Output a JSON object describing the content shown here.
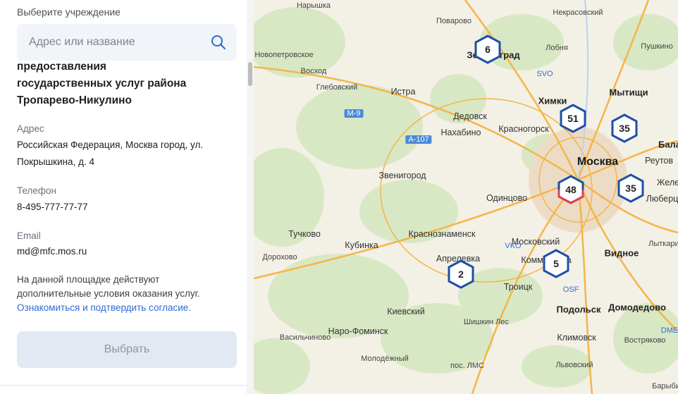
{
  "panel": {
    "title": "Выберите учреждение",
    "search_placeholder": "Адрес или название",
    "org_name_lines": [
      "предоставления",
      "государственных услуг района",
      "Тропарево-Никулино"
    ],
    "address_label": "Адрес",
    "address_value": "Российская Федерация, Москва город, ул. Покрышкина, д. 4",
    "phone_label": "Телефон",
    "phone_value": "8-495-777-77-77",
    "email_label": "Email",
    "email_value": "md@mfc.mos.ru",
    "note_text": "На данной площадке действуют дополнительные условия оказания услуг.",
    "note_link": "Ознакомиться и подтвердить согласие.",
    "select_button": "Выбрать"
  },
  "map": {
    "clusters": [
      {
        "count": "6"
      },
      {
        "count": "51"
      },
      {
        "count": "35"
      },
      {
        "count": "48",
        "selected": true
      },
      {
        "count": "35"
      },
      {
        "count": "2"
      },
      {
        "count": "5"
      }
    ],
    "places": [
      "Нарышка",
      "Поварово",
      "Некрасовский",
      "Лобня",
      "Пушкино",
      "Новопетровское",
      "Восход",
      "Глебовский",
      "Истра",
      "Химки",
      "Мытищи",
      "Дедовск",
      "Нахабино",
      "Красногорск",
      "Москва",
      "Реутов",
      "Звенигород",
      "Одинцово",
      "Тучково",
      "Кубинка",
      "Краснознаменск",
      "Московский",
      "Дорохово",
      "Апрелевка",
      "Видное",
      "Троицк",
      "Подольск",
      "Домодедово",
      "Киевский",
      "Шишкин Лес",
      "Наро-Фоминск",
      "Васильчиново",
      "Климовск",
      "Востряково",
      "Молодёжный",
      "пос. ЛМС",
      "Львовский",
      "Лыткарино",
      "Бала",
      "Желе",
      "Люберцы",
      "Коммунарка",
      "Зеленоград",
      "Барыби"
    ],
    "road_labels": [
      "М-9",
      "А-107"
    ],
    "airports": [
      "SVO",
      "VKO",
      "OSF",
      "DME"
    ],
    "colors": {
      "cluster_border": "#1e4fa8",
      "cluster_selected": "#e0405a",
      "road": "#f5b547"
    }
  }
}
